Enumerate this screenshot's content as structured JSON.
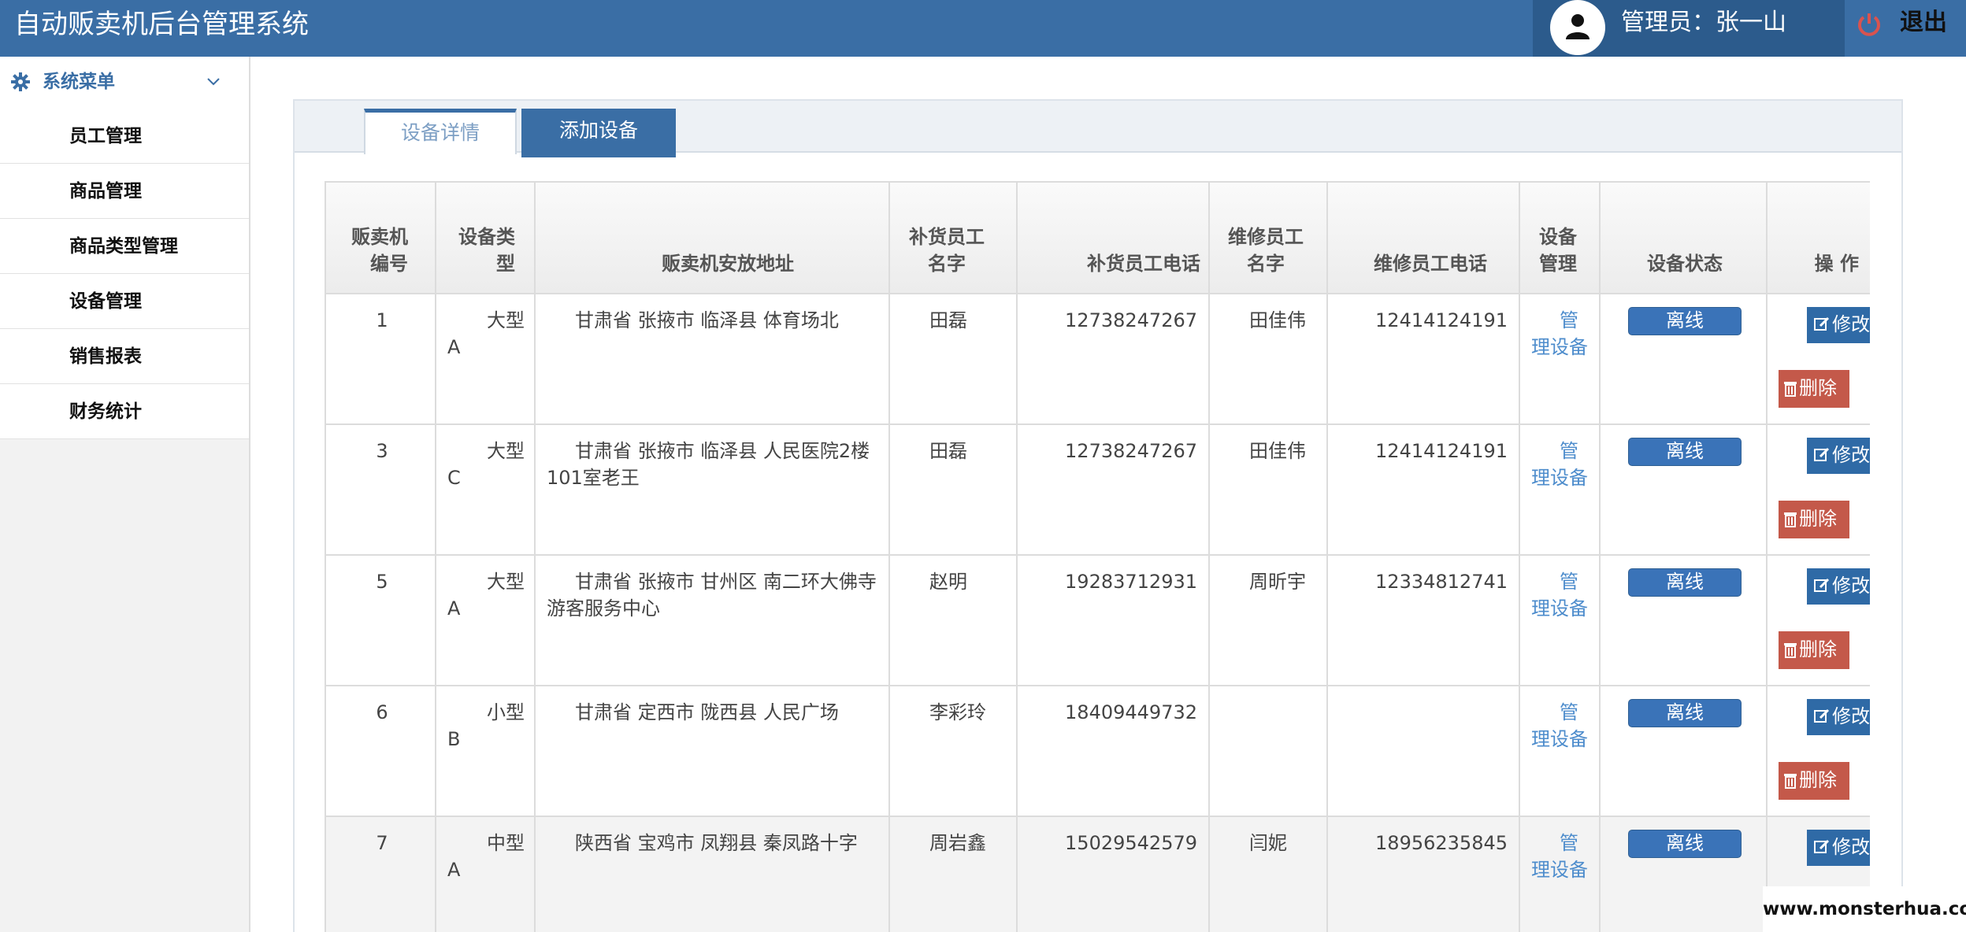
{
  "app": {
    "title": "自动贩卖机后台管理系统"
  },
  "user": {
    "label": "管理员：张一山",
    "logout_label": "退出"
  },
  "sidebar": {
    "header": "系统菜单",
    "items": [
      {
        "label": "员工管理"
      },
      {
        "label": "商品管理"
      },
      {
        "label": "商品类型管理"
      },
      {
        "label": "设备管理"
      },
      {
        "label": "销售报表"
      },
      {
        "label": "财务统计"
      }
    ]
  },
  "tabs": [
    {
      "label": "设备详情",
      "active": true
    },
    {
      "label": "添加设备",
      "active": false
    }
  ],
  "table": {
    "headers": [
      "贩卖机编号",
      "设备类型",
      "贩卖机安放地址",
      "补货员工名字",
      "补货员工电话",
      "维修员工名字",
      "维修员工电话",
      "设备管理",
      "设备状态",
      "操 作"
    ],
    "rows": [
      {
        "id": "1",
        "type": "大型A",
        "address": "甘肃省 张掖市 临泽县 体育场北",
        "restock_name": "田磊",
        "restock_phone": "12738247267",
        "repair_name": "田佳伟",
        "repair_phone": "12414124191",
        "manage": "管理设备",
        "status": "离线",
        "edit": "修改",
        "delete": "删除"
      },
      {
        "id": "3",
        "type": "大型C",
        "address": "甘肃省 张掖市 临泽县 人民医院2楼101室老王",
        "restock_name": "田磊",
        "restock_phone": "12738247267",
        "repair_name": "田佳伟",
        "repair_phone": "12414124191",
        "manage": "管理设备",
        "status": "离线",
        "edit": "修改",
        "delete": "删除"
      },
      {
        "id": "5",
        "type": "大型A",
        "address": "甘肃省 张掖市 甘州区 南二环大佛寺游客服务中心",
        "restock_name": "赵明",
        "restock_phone": "19283712931",
        "repair_name": "周昕宇",
        "repair_phone": "12334812741",
        "manage": "管理设备",
        "status": "离线",
        "edit": "修改",
        "delete": "删除"
      },
      {
        "id": "6",
        "type": "小型B",
        "address": "甘肃省 定西市 陇西县 人民广场",
        "restock_name": "李彩玲",
        "restock_phone": "18409449732",
        "repair_name": "",
        "repair_phone": "",
        "manage": "管理设备",
        "status": "离线",
        "edit": "修改",
        "delete": "删除"
      },
      {
        "id": "7",
        "type": "中型A",
        "address": "陕西省 宝鸡市 凤翔县 秦凤路十字",
        "restock_name": "周岩鑫",
        "restock_phone": "15029542579",
        "repair_name": "闫妮",
        "repair_phone": "18956235845",
        "manage": "管理设备",
        "status": "离线",
        "edit": "修改",
        "delete": ""
      }
    ]
  },
  "watermark": "www.monsterhua.com",
  "colors": {
    "primary": "#3a6ea5",
    "danger": "#c4594a",
    "link": "#4d8ccc"
  }
}
